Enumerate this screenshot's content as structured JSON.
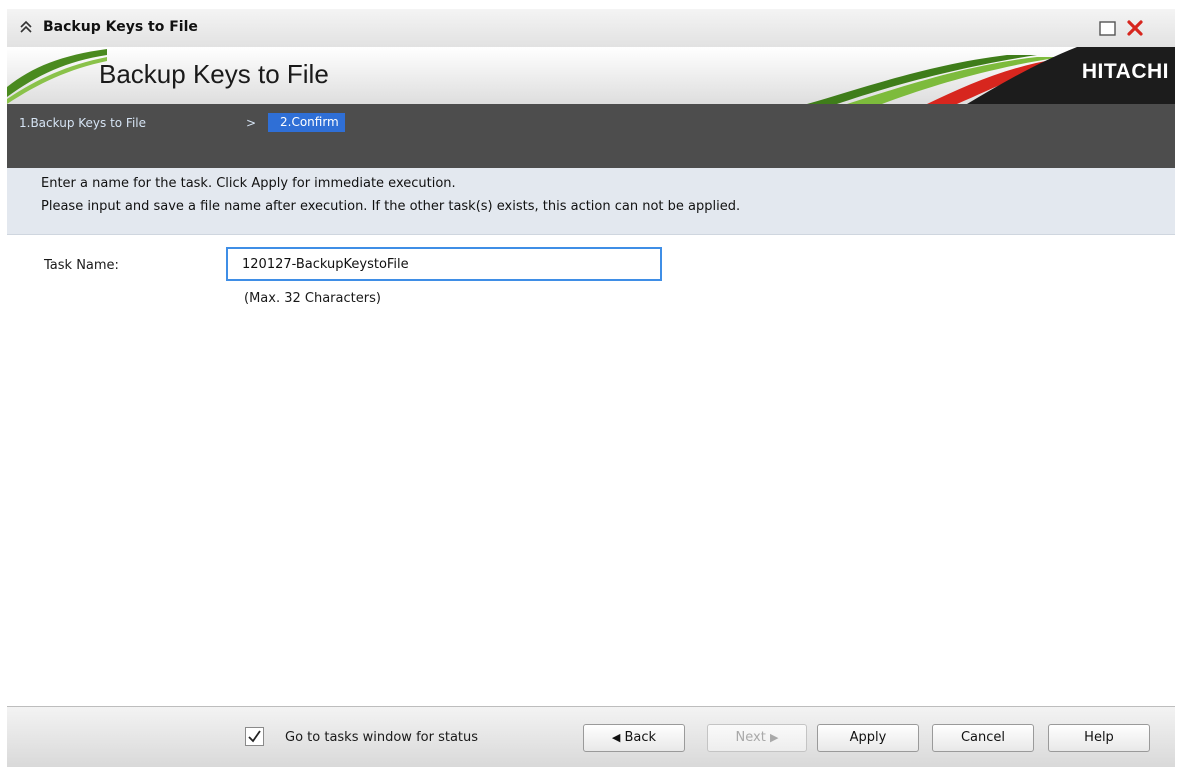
{
  "window": {
    "title": "Backup Keys to File"
  },
  "banner": {
    "title": "Backup Keys to File",
    "logo": "HITACHI"
  },
  "steps": {
    "items": [
      {
        "label": "1.Backup Keys to File",
        "active": false
      },
      {
        "label": "2.Confirm",
        "active": true
      }
    ],
    "separator": ">"
  },
  "instructions": {
    "line1": "Enter a name for the task. Click Apply for immediate execution.",
    "line2": "Please input and save a file name after execution. If the other task(s) exists, this action can not be applied."
  },
  "form": {
    "task_name_label": "Task Name:",
    "task_name_value": "120127-BackupKeystoFile",
    "task_name_hint": "(Max. 32 Characters)"
  },
  "footer": {
    "checkbox_label": "Go to tasks window for status",
    "checkbox_checked": true,
    "back_label": "Back",
    "next_label": "Next",
    "apply_label": "Apply",
    "cancel_label": "Cancel",
    "help_label": "Help"
  },
  "colors": {
    "accent": "#2f6fd6",
    "steps_bar": "#4d4d4d",
    "instruction_bg": "#e3e8ef",
    "close_red": "#d7261e"
  }
}
